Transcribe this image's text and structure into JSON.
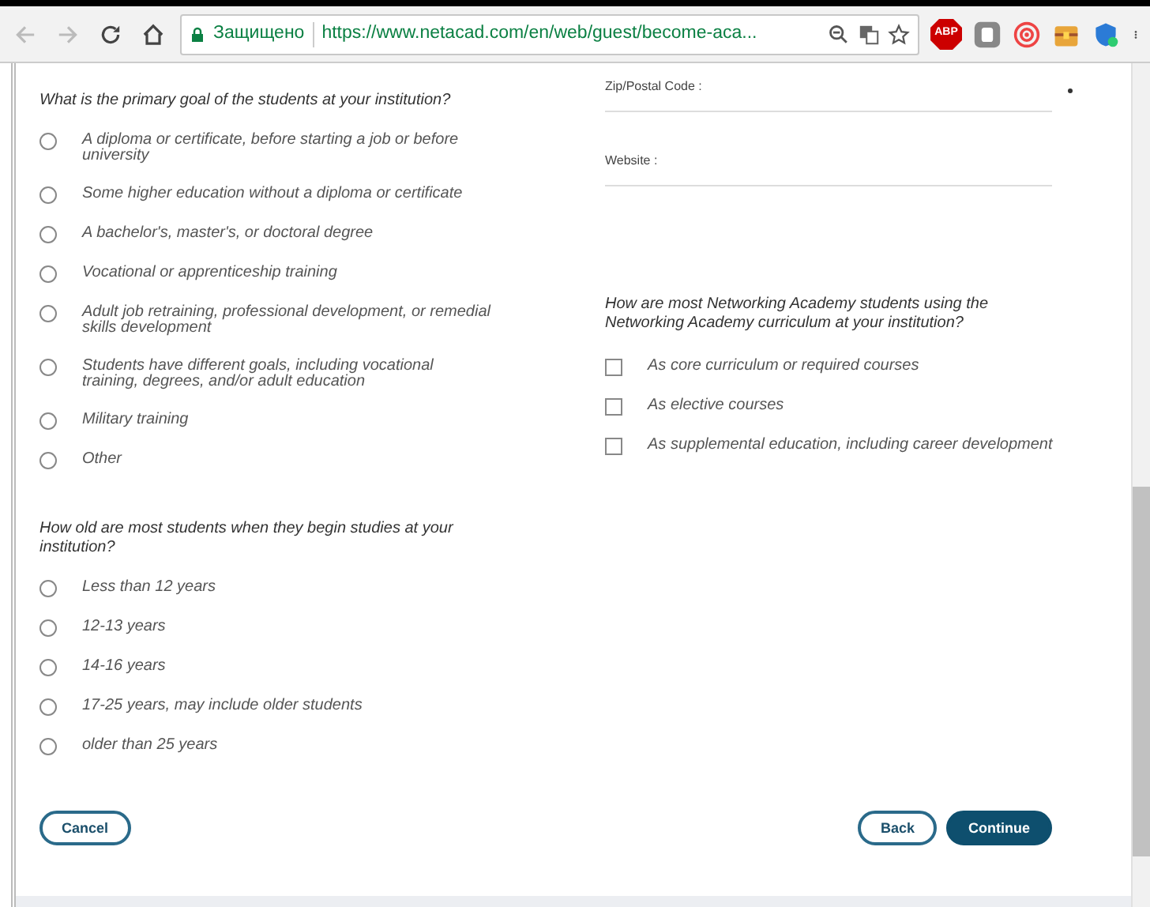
{
  "browser": {
    "back_disabled": true,
    "forward_disabled": true,
    "secure_label": "Защищено",
    "url": "https://www.netacad.com/en/web/guest/become-aca...",
    "abp_label": "ABP"
  },
  "goal_question": {
    "text": "What is the primary goal of the students at your institution?",
    "options": [
      {
        "label": "A diploma or certificate, before starting a job or before university",
        "selected": false
      },
      {
        "label": "Some higher education without a diploma or certificate",
        "selected": false
      },
      {
        "label": "A bachelor's, master's, or doctoral degree",
        "selected": false
      },
      {
        "label": "Vocational or apprenticeship training",
        "selected": false
      },
      {
        "label": "Adult job retraining, professional development, or remedial skills development",
        "selected": false
      },
      {
        "label": "Students have different goals, including vocational training, degrees, and/or adult education",
        "selected": false
      },
      {
        "label": "Military training",
        "selected": false
      },
      {
        "label": "Other",
        "selected": false
      }
    ]
  },
  "age_question": {
    "text": "How old are most students when they begin studies at your institution?",
    "options": [
      {
        "label": "Less than 12 years",
        "selected": false
      },
      {
        "label": "12-13 years",
        "selected": false
      },
      {
        "label": "14-16 years",
        "selected": false
      },
      {
        "label": "17-25 years, may include older students",
        "selected": false
      },
      {
        "label": "older than 25 years",
        "selected": false
      }
    ]
  },
  "fields": [
    {
      "label": "Zip/Postal Code :",
      "required": true
    },
    {
      "label": "Website :",
      "required": false
    }
  ],
  "curriculum_question": {
    "text": "How are most Networking Academy students using the Networking Academy curriculum at your institution?",
    "options": [
      {
        "label": "As core curriculum or required courses",
        "checked": false
      },
      {
        "label": "As elective courses",
        "checked": false
      },
      {
        "label": "As supplemental education, including career development",
        "checked": false
      }
    ]
  },
  "buttons": [
    {
      "label": "Cancel",
      "kind": "outline"
    },
    {
      "label": "Back",
      "kind": "outline"
    },
    {
      "label": "Continue",
      "kind": "primary"
    }
  ]
}
